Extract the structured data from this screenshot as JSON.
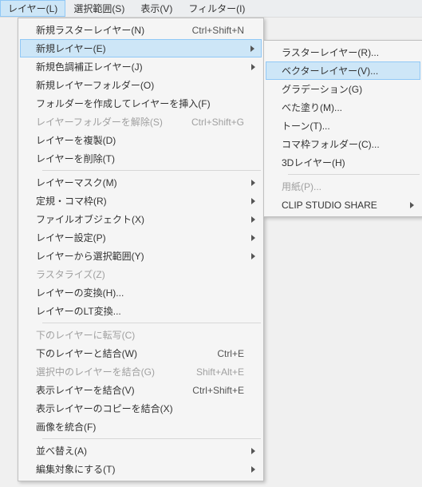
{
  "menubar": {
    "items": [
      "レイヤー(L)",
      "選択範囲(S)",
      "表示(V)",
      "フィルター(I)"
    ]
  },
  "main_menu": {
    "items": [
      {
        "label": "新規ラスターレイヤー(N)",
        "shortcut": "Ctrl+Shift+N"
      },
      {
        "label": "新規レイヤー(E)",
        "submenu": true,
        "highlighted": true
      },
      {
        "label": "新規色調補正レイヤー(J)",
        "submenu": true
      },
      {
        "label": "新規レイヤーフォルダー(O)"
      },
      {
        "label": "フォルダーを作成してレイヤーを挿入(F)"
      },
      {
        "label": "レイヤーフォルダーを解除(S)",
        "shortcut": "Ctrl+Shift+G",
        "disabled": true
      },
      {
        "label": "レイヤーを複製(D)"
      },
      {
        "label": "レイヤーを削除(T)"
      },
      {
        "separator": true
      },
      {
        "label": "レイヤーマスク(M)",
        "submenu": true
      },
      {
        "label": "定規・コマ枠(R)",
        "submenu": true
      },
      {
        "label": "ファイルオブジェクト(X)",
        "submenu": true
      },
      {
        "label": "レイヤー設定(P)",
        "submenu": true
      },
      {
        "label": "レイヤーから選択範囲(Y)",
        "submenu": true
      },
      {
        "label": "ラスタライズ(Z)",
        "disabled": true
      },
      {
        "label": "レイヤーの変換(H)..."
      },
      {
        "label": "レイヤーのLT変換..."
      },
      {
        "separator": true
      },
      {
        "label": "下のレイヤーに転写(C)",
        "disabled": true
      },
      {
        "label": "下のレイヤーと結合(W)",
        "shortcut": "Ctrl+E"
      },
      {
        "label": "選択中のレイヤーを結合(G)",
        "shortcut": "Shift+Alt+E",
        "disabled": true
      },
      {
        "label": "表示レイヤーを結合(V)",
        "shortcut": "Ctrl+Shift+E"
      },
      {
        "label": "表示レイヤーのコピーを結合(X)"
      },
      {
        "label": "画像を統合(F)"
      },
      {
        "separator": true
      },
      {
        "label": "並べ替え(A)",
        "submenu": true
      },
      {
        "label": "編集対象にする(T)",
        "submenu": true
      }
    ]
  },
  "sub_menu": {
    "items": [
      {
        "label": "ラスターレイヤー(R)..."
      },
      {
        "label": "ベクターレイヤー(V)...",
        "highlighted": true
      },
      {
        "label": "グラデーション(G)"
      },
      {
        "label": "べた塗り(M)..."
      },
      {
        "label": "トーン(T)..."
      },
      {
        "label": "コマ枠フォルダー(C)..."
      },
      {
        "label": "3Dレイヤー(H)"
      },
      {
        "separator": true
      },
      {
        "label": "用紙(P)...",
        "disabled": true
      },
      {
        "label": "CLIP STUDIO SHARE",
        "submenu": true
      }
    ]
  }
}
